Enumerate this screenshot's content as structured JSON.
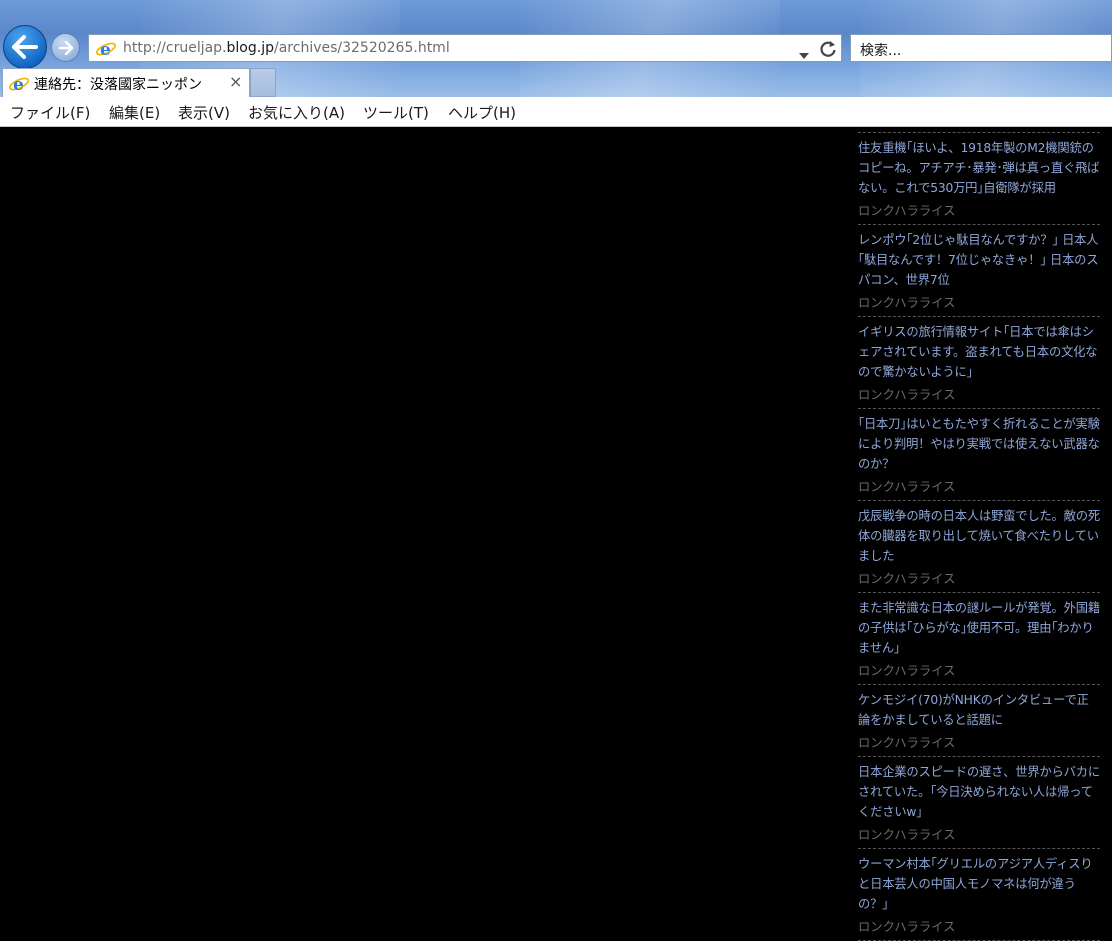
{
  "browser": {
    "url_prefix": "http://crueljap.",
    "url_domain": "blog.jp",
    "url_path": "/archives/32520265.html",
    "search_placeholder": "検索...",
    "tab_title": "連絡先：没落國家ニッポン",
    "tab_close": "×"
  },
  "menu": [
    "ファイル(F)",
    "編集(E)",
    "表示(V)",
    "お気に入り(A)",
    "ツール(T)",
    "ヘルプ(H)"
  ],
  "sidebar": {
    "entries": [
      {
        "headline": "住友重機｢ほいよ、1918年製のM2機関銃のコピーね。アチアチ･暴発･弾は真っ直ぐ飛ばない。これで530万円｣自衛隊が採用",
        "source": "ロンクハラライス"
      },
      {
        "headline": "レンポウ｢2位じゃ駄目なんですか？｣ 日本人｢駄目なんです！7位じゃなきゃ！｣ 日本のスパコン、世界7位",
        "source": "ロンクハラライス"
      },
      {
        "headline": "イギリスの旅行情報サイト｢日本では傘はシェアされています。盗まれても日本の文化なので驚かないように｣",
        "source": "ロンクハラライス"
      },
      {
        "headline": "｢日本刀｣はいともたやすく折れることが実験により判明！やはり実戦では使えない武器なのか？",
        "source": "ロンクハラライス"
      },
      {
        "headline": "戊辰戦争の時の日本人は野蛮でした。敵の死体の臓器を取り出して焼いて食べたりしていました",
        "source": "ロンクハラライス"
      },
      {
        "headline": "また非常識な日本の謎ルールが発覚。外国籍の子供は｢ひらがな｣使用不可。理由｢わかりません｣",
        "source": "ロンクハラライス"
      },
      {
        "headline": "ケンモジイ(70)がNHKのインタビューで正論をかましていると話題に",
        "source": "ロンクハラライス"
      },
      {
        "headline": "日本企業のスピードの遅さ、世界からバカにされていた。｢今日決められない人は帰ってくださいw｣",
        "source": "ロンクハラライス"
      },
      {
        "headline": "ウーマン村本｢グリエルのアジア人ディスりと日本芸人の中国人モノマネは何が違うの？｣",
        "source": "ロンクハラライス"
      }
    ]
  }
}
